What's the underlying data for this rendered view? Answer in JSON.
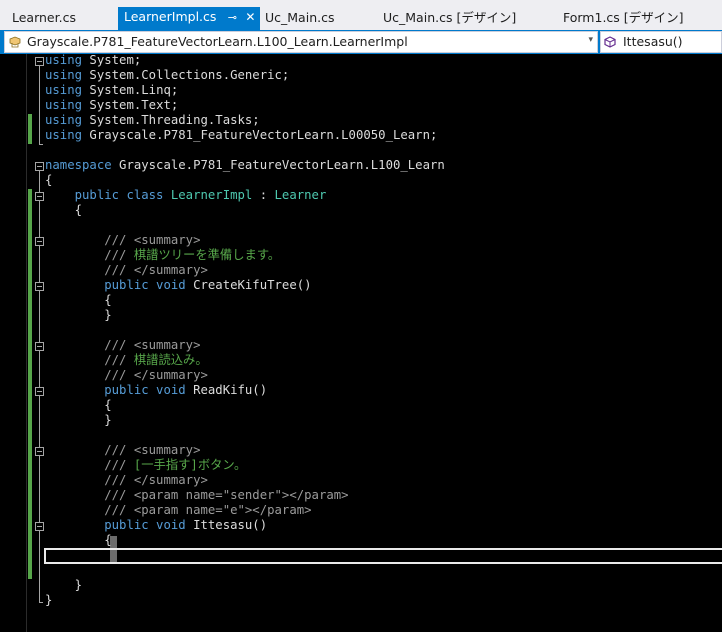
{
  "tabs": [
    {
      "label": "Learner.cs",
      "active": false
    },
    {
      "label": "LearnerImpl.cs",
      "active": true,
      "pin_glyph": "⊸",
      "close_glyph": "✕"
    },
    {
      "label": "Uc_Main.cs",
      "active": false
    },
    {
      "label": "Uc_Main.cs [デザイン]",
      "active": false
    },
    {
      "label": "Form1.cs [デザイン]",
      "active": false
    }
  ],
  "navbar": {
    "class_path": "Grayscale.P781_FeatureVectorLearn.L100_Learn.LearnerImpl",
    "member": "Ittesasu()",
    "dropdown_glyph": "▾"
  },
  "code": {
    "l1": {
      "kw": "using",
      "rest": " System;"
    },
    "l2": {
      "kw": "using",
      "rest": " System.Collections.Generic;"
    },
    "l3": {
      "kw": "using",
      "rest": " System.Linq;"
    },
    "l4": {
      "kw": "using",
      "rest": " System.Text;"
    },
    "l5": {
      "kw": "using",
      "rest": " System.Threading.Tasks;"
    },
    "l6": {
      "kw": "using",
      "rest": " Grayscale.P781_FeatureVectorLearn.L00050_Learn;"
    },
    "l8": {
      "kw": "namespace",
      "rest": " Grayscale.P781_FeatureVectorLearn.L100_Learn"
    },
    "l9": {
      "text": "{"
    },
    "l10": {
      "indent": "    ",
      "kw": "public class",
      "sp1": " ",
      "cls": "LearnerImpl",
      "colon": " : ",
      "base": "Learner"
    },
    "l11": {
      "text": "    {"
    },
    "l13": {
      "slash": "        /// ",
      "tag": "<summary>"
    },
    "l14": {
      "slash": "        /// ",
      "text": "棋譜ツリーを準備します。"
    },
    "l15": {
      "slash": "        /// ",
      "tag": "</summary>"
    },
    "l16": {
      "indent": "        ",
      "kw": "public void",
      "rest": " CreateKifuTree()"
    },
    "l17": {
      "text": "        {"
    },
    "l18": {
      "text": "        }"
    },
    "l20": {
      "slash": "        /// ",
      "tag": "<summary>"
    },
    "l21": {
      "slash": "        /// ",
      "text": "棋譜読込み。"
    },
    "l22": {
      "slash": "        /// ",
      "tag": "</summary>"
    },
    "l23": {
      "indent": "        ",
      "kw": "public void",
      "rest": " ReadKifu()"
    },
    "l24": {
      "text": "        {"
    },
    "l25": {
      "text": "        }"
    },
    "l27": {
      "slash": "        /// ",
      "tag": "<summary>"
    },
    "l28": {
      "slash": "        /// ",
      "text": "[一手指す]ボタン。"
    },
    "l29": {
      "slash": "        /// ",
      "tag": "</summary>"
    },
    "l30": {
      "slash": "        /// ",
      "tag_open": "<param name=",
      "val": "\"sender\"",
      "tag_close": "></param>"
    },
    "l31": {
      "slash": "        /// ",
      "tag_open": "<param name=",
      "val": "\"e\"",
      "tag_close": "></param>"
    },
    "l32": {
      "indent": "        ",
      "kw": "public void",
      "rest": " Ittesasu()"
    },
    "l33": {
      "text": "        {"
    },
    "l36": {
      "text": "    }"
    },
    "l37": {
      "text": "}"
    }
  }
}
